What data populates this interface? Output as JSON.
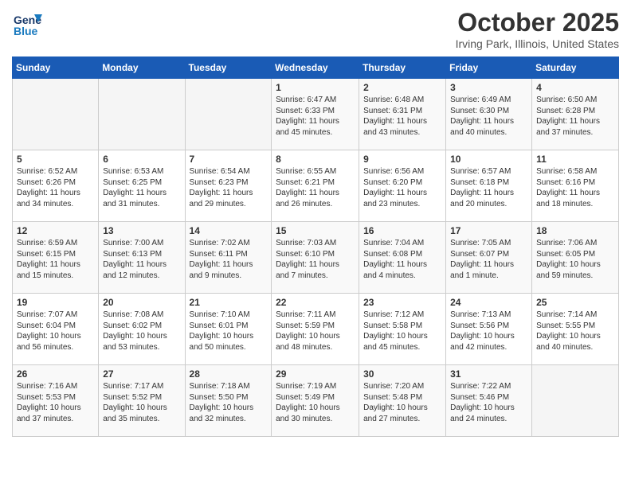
{
  "header": {
    "logo": {
      "text_general": "General",
      "text_blue": "Blue"
    },
    "month": "October 2025",
    "location": "Irving Park, Illinois, United States"
  },
  "weekdays": [
    "Sunday",
    "Monday",
    "Tuesday",
    "Wednesday",
    "Thursday",
    "Friday",
    "Saturday"
  ],
  "weeks": [
    [
      {
        "day": "",
        "info": ""
      },
      {
        "day": "",
        "info": ""
      },
      {
        "day": "",
        "info": ""
      },
      {
        "day": "1",
        "info": "Sunrise: 6:47 AM\nSunset: 6:33 PM\nDaylight: 11 hours\nand 45 minutes."
      },
      {
        "day": "2",
        "info": "Sunrise: 6:48 AM\nSunset: 6:31 PM\nDaylight: 11 hours\nand 43 minutes."
      },
      {
        "day": "3",
        "info": "Sunrise: 6:49 AM\nSunset: 6:30 PM\nDaylight: 11 hours\nand 40 minutes."
      },
      {
        "day": "4",
        "info": "Sunrise: 6:50 AM\nSunset: 6:28 PM\nDaylight: 11 hours\nand 37 minutes."
      }
    ],
    [
      {
        "day": "5",
        "info": "Sunrise: 6:52 AM\nSunset: 6:26 PM\nDaylight: 11 hours\nand 34 minutes."
      },
      {
        "day": "6",
        "info": "Sunrise: 6:53 AM\nSunset: 6:25 PM\nDaylight: 11 hours\nand 31 minutes."
      },
      {
        "day": "7",
        "info": "Sunrise: 6:54 AM\nSunset: 6:23 PM\nDaylight: 11 hours\nand 29 minutes."
      },
      {
        "day": "8",
        "info": "Sunrise: 6:55 AM\nSunset: 6:21 PM\nDaylight: 11 hours\nand 26 minutes."
      },
      {
        "day": "9",
        "info": "Sunrise: 6:56 AM\nSunset: 6:20 PM\nDaylight: 11 hours\nand 23 minutes."
      },
      {
        "day": "10",
        "info": "Sunrise: 6:57 AM\nSunset: 6:18 PM\nDaylight: 11 hours\nand 20 minutes."
      },
      {
        "day": "11",
        "info": "Sunrise: 6:58 AM\nSunset: 6:16 PM\nDaylight: 11 hours\nand 18 minutes."
      }
    ],
    [
      {
        "day": "12",
        "info": "Sunrise: 6:59 AM\nSunset: 6:15 PM\nDaylight: 11 hours\nand 15 minutes."
      },
      {
        "day": "13",
        "info": "Sunrise: 7:00 AM\nSunset: 6:13 PM\nDaylight: 11 hours\nand 12 minutes."
      },
      {
        "day": "14",
        "info": "Sunrise: 7:02 AM\nSunset: 6:11 PM\nDaylight: 11 hours\nand 9 minutes."
      },
      {
        "day": "15",
        "info": "Sunrise: 7:03 AM\nSunset: 6:10 PM\nDaylight: 11 hours\nand 7 minutes."
      },
      {
        "day": "16",
        "info": "Sunrise: 7:04 AM\nSunset: 6:08 PM\nDaylight: 11 hours\nand 4 minutes."
      },
      {
        "day": "17",
        "info": "Sunrise: 7:05 AM\nSunset: 6:07 PM\nDaylight: 11 hours\nand 1 minute."
      },
      {
        "day": "18",
        "info": "Sunrise: 7:06 AM\nSunset: 6:05 PM\nDaylight: 10 hours\nand 59 minutes."
      }
    ],
    [
      {
        "day": "19",
        "info": "Sunrise: 7:07 AM\nSunset: 6:04 PM\nDaylight: 10 hours\nand 56 minutes."
      },
      {
        "day": "20",
        "info": "Sunrise: 7:08 AM\nSunset: 6:02 PM\nDaylight: 10 hours\nand 53 minutes."
      },
      {
        "day": "21",
        "info": "Sunrise: 7:10 AM\nSunset: 6:01 PM\nDaylight: 10 hours\nand 50 minutes."
      },
      {
        "day": "22",
        "info": "Sunrise: 7:11 AM\nSunset: 5:59 PM\nDaylight: 10 hours\nand 48 minutes."
      },
      {
        "day": "23",
        "info": "Sunrise: 7:12 AM\nSunset: 5:58 PM\nDaylight: 10 hours\nand 45 minutes."
      },
      {
        "day": "24",
        "info": "Sunrise: 7:13 AM\nSunset: 5:56 PM\nDaylight: 10 hours\nand 42 minutes."
      },
      {
        "day": "25",
        "info": "Sunrise: 7:14 AM\nSunset: 5:55 PM\nDaylight: 10 hours\nand 40 minutes."
      }
    ],
    [
      {
        "day": "26",
        "info": "Sunrise: 7:16 AM\nSunset: 5:53 PM\nDaylight: 10 hours\nand 37 minutes."
      },
      {
        "day": "27",
        "info": "Sunrise: 7:17 AM\nSunset: 5:52 PM\nDaylight: 10 hours\nand 35 minutes."
      },
      {
        "day": "28",
        "info": "Sunrise: 7:18 AM\nSunset: 5:50 PM\nDaylight: 10 hours\nand 32 minutes."
      },
      {
        "day": "29",
        "info": "Sunrise: 7:19 AM\nSunset: 5:49 PM\nDaylight: 10 hours\nand 30 minutes."
      },
      {
        "day": "30",
        "info": "Sunrise: 7:20 AM\nSunset: 5:48 PM\nDaylight: 10 hours\nand 27 minutes."
      },
      {
        "day": "31",
        "info": "Sunrise: 7:22 AM\nSunset: 5:46 PM\nDaylight: 10 hours\nand 24 minutes."
      },
      {
        "day": "",
        "info": ""
      }
    ]
  ]
}
